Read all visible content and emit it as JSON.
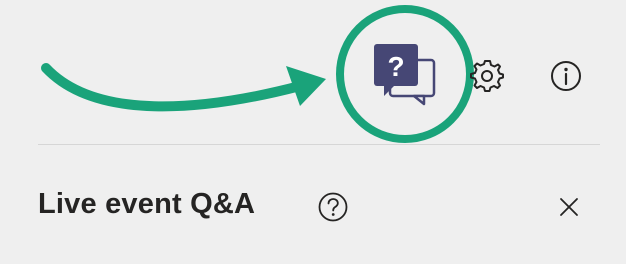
{
  "toolbar": {
    "icons": {
      "qa": "qa-chat-bubbles-icon",
      "settings": "gear-icon",
      "info": "info-icon"
    },
    "qa_glyph": "?"
  },
  "annotation": {
    "icon": "curved-arrow-icon",
    "color": "#1aa37a"
  },
  "panel": {
    "title": "Live event Q&A",
    "help_icon": "help-circle-icon",
    "close_icon": "close-icon"
  },
  "colors": {
    "background": "#efefef",
    "qa_icon": "#464775",
    "highlight": "#1aa37a",
    "text": "#252423",
    "divider": "#d6d6d6"
  }
}
